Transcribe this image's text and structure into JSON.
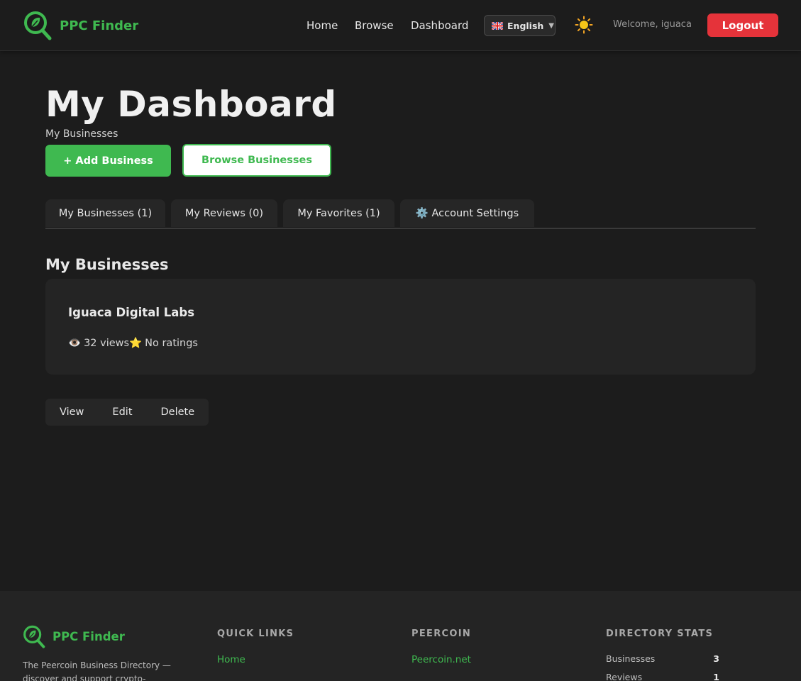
{
  "header": {
    "brand": "PPC Finder",
    "nav": [
      {
        "label": "Home"
      },
      {
        "label": "Browse"
      },
      {
        "label": "Dashboard"
      }
    ],
    "language": "English",
    "welcome": "Welcome, iguaca",
    "logout_label": "Logout",
    "theme_icon": "sun-icon"
  },
  "main": {
    "title": "My Dashboard",
    "subtitle": "My Businesses",
    "add_button": "+ Add Business",
    "browse_button": "Browse Businesses",
    "tabs": [
      {
        "label": "My Businesses (1)"
      },
      {
        "label": "My Reviews (0)"
      },
      {
        "label": "My Favorites (1)"
      },
      {
        "label": "⚙️ Account Settings"
      }
    ],
    "section_title": "My Businesses",
    "business": {
      "name": "Iguaca Digital Labs",
      "views_icon": "👁️",
      "views": "32 views",
      "rating_icon": "⭐",
      "rating": "No ratings"
    },
    "actions": {
      "view": "View",
      "edit": "Edit",
      "delete": "Delete"
    }
  },
  "footer": {
    "brand": "PPC Finder",
    "description": "The Peercoin Business Directory — discover and support crypto-",
    "quick_links": {
      "heading": "QUICK LINKS",
      "items": [
        "Home"
      ]
    },
    "peercoin": {
      "heading": "PEERCOIN",
      "items": [
        "Peercoin.net"
      ]
    },
    "stats": {
      "heading": "DIRECTORY STATS",
      "rows": [
        {
          "label": "Businesses",
          "value": "3"
        },
        {
          "label": "Reviews",
          "value": "1"
        }
      ]
    }
  },
  "colors": {
    "accent": "#3fb950",
    "danger": "#e5333a",
    "background": "#1c1c1c",
    "surface": "#242424"
  }
}
